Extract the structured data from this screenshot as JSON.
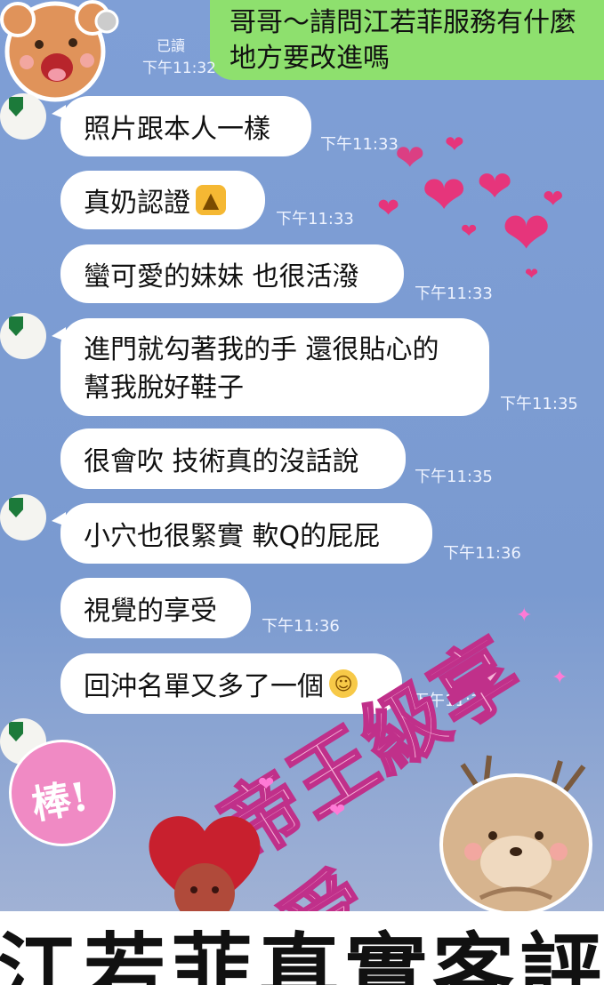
{
  "outgoing": {
    "lines": [
      "哥哥～請問江若菲服務有什麼",
      "地方要改進嗎"
    ],
    "read_label": "已讀",
    "time": "下午11:32"
  },
  "messages": [
    {
      "text": "照片跟本人一樣",
      "time": "下午11:33"
    },
    {
      "text": "真奶認證",
      "emoji": "thumbs-up",
      "time": "下午11:33"
    },
    {
      "text": "蠻可愛的妹妹 也很活潑",
      "time": "下午11:33"
    },
    {
      "lines": [
        "進門就勾著我的手 還很貼心的",
        "幫我脫好鞋子"
      ],
      "time": "下午11:35"
    },
    {
      "text": "很會吹 技術真的沒話說",
      "time": "下午11:35"
    },
    {
      "text": "小穴也很緊實 軟Q的屁屁",
      "time": "下午11:36"
    },
    {
      "text": "視覺的享受",
      "time": "下午11:36"
    },
    {
      "text": "回沖名單又多了一個",
      "emoji": "rolling-laughing",
      "time": "下午11:36"
    }
  ],
  "stamp": {
    "text": "帝王級享受"
  },
  "sticker_sign": {
    "text": "棒!"
  },
  "banner": {
    "text": "江若菲真實客評"
  },
  "colors": {
    "background": "#7d9dd3",
    "outgoing_bubble": "#8ee06e",
    "incoming_bubble": "#ffffff",
    "hearts": "#e6357b",
    "stamp_fill": "#f7b3d8",
    "stamp_stroke": "#c0308a"
  },
  "icons": [
    "bear-sticker",
    "pen-avatar",
    "heart-cluster",
    "thumbs-up",
    "rolling-laughing",
    "deer-sticker",
    "heart-sticker"
  ]
}
